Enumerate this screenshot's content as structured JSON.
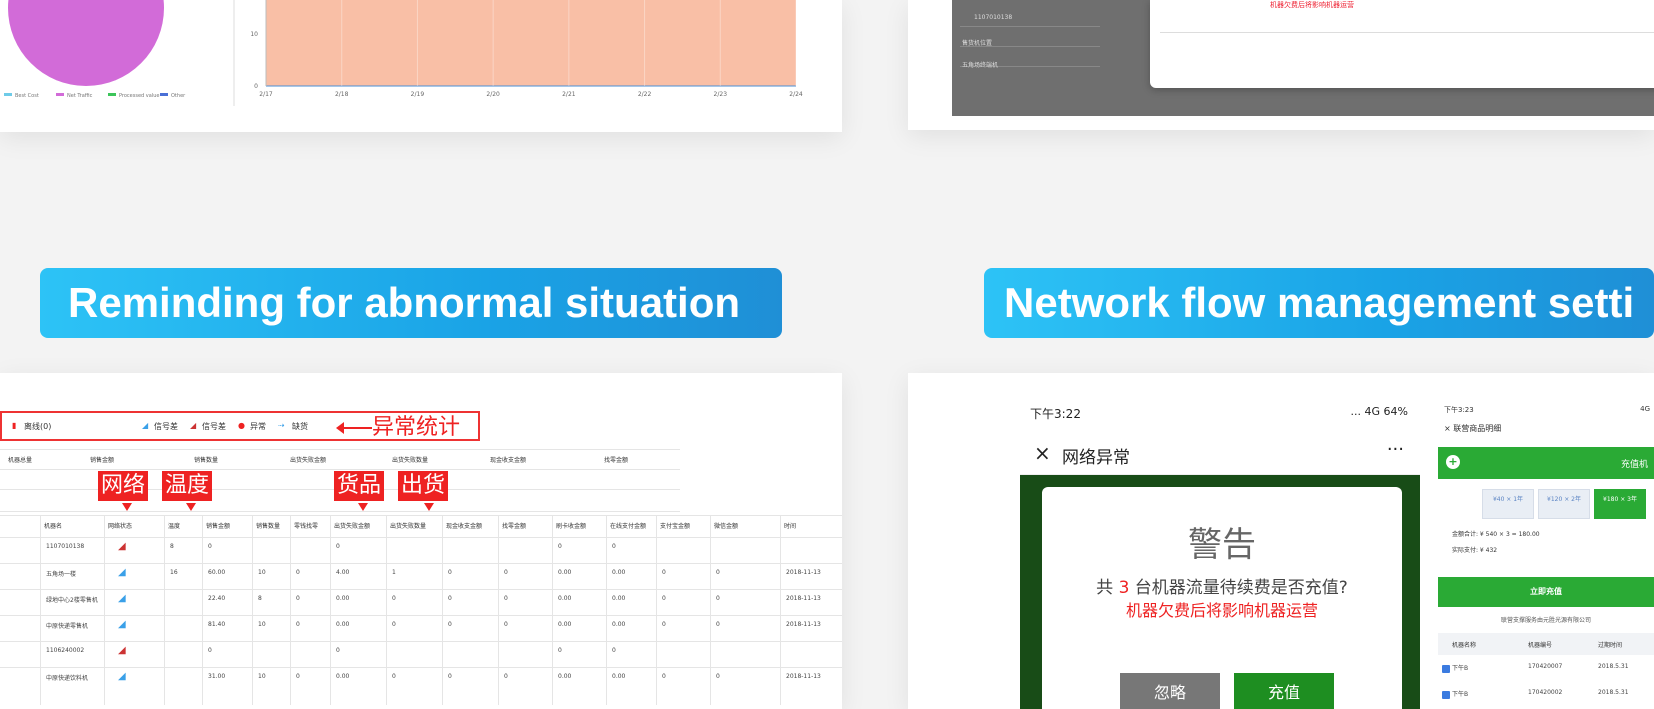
{
  "sections": {
    "left_title": "Reminding for abnormal situation",
    "right_title": "Network flow management setti"
  },
  "top_left": {
    "legend": [
      "Best Cost",
      "Net Traffic",
      "Processed value",
      "Other"
    ],
    "x_ticks": [
      "2/17",
      "2/18",
      "2/19",
      "2/20",
      "2/21",
      "2/22",
      "2/23",
      "2/24"
    ],
    "y_ticks": [
      "10",
      "0"
    ],
    "colors": {
      "pie": "#d26bd8",
      "area": "#f9bfa6"
    }
  },
  "top_right": {
    "rows": [
      "1107010138",
      "售货机位置",
      "五角场终端机"
    ],
    "modal_warning": "机器欠费后将影响机器运营"
  },
  "abnormal": {
    "legend_items": [
      "离线(0)",
      "信号差",
      "异常",
      "缺货"
    ],
    "stat_label": "异常统计",
    "tags": [
      "网络",
      "温度",
      "货品",
      "出货"
    ],
    "header_top": [
      "机器总量",
      "销售金额",
      "销售数量",
      "出货失败金额",
      "出货失败数量",
      "现金收支金额",
      "找零金额"
    ],
    "header": [
      "机器名",
      "网络状态",
      "温度",
      "销售金额",
      "销售数量",
      "零钱找零",
      "出货失败金额",
      "出货失败数量",
      "现金收支金额",
      "找零金额",
      "刷卡收金额",
      "在线支付金额",
      "支付宝金额",
      "微信金额",
      "时间"
    ],
    "rows": [
      [
        "1107010138",
        "",
        "8",
        "0",
        "",
        "",
        "0",
        "",
        "",
        "",
        "0",
        "0",
        "",
        "",
        ""
      ],
      [
        "五角场一楼",
        "",
        "16",
        "60.00",
        "10",
        "0",
        "4.00",
        "1",
        "0",
        "0",
        "0.00",
        "0.00",
        "0",
        "0",
        "2018-11-13"
      ],
      [
        "绿地中心2楼零售机",
        "",
        "",
        "22.40",
        "8",
        "0",
        "0.00",
        "0",
        "0",
        "0",
        "0.00",
        "0.00",
        "0",
        "0",
        "2018-11-13"
      ],
      [
        "中原快递零售机",
        "",
        "",
        "81.40",
        "10",
        "0",
        "0.00",
        "0",
        "0",
        "0",
        "0.00",
        "0.00",
        "0",
        "0",
        "2018-11-13"
      ],
      [
        "1106240002",
        "",
        "",
        "0",
        "",
        "",
        "0",
        "",
        "",
        "",
        "0",
        "0",
        "",
        "",
        ""
      ],
      [
        "中原快递饮料机",
        "",
        "",
        "31.00",
        "10",
        "0",
        "0.00",
        "0",
        "0",
        "0",
        "0.00",
        "0.00",
        "0",
        "0",
        "2018-11-13"
      ]
    ]
  },
  "phone": {
    "time": "下午3:22",
    "status_right": "... 4G 64%",
    "close_icon": "×",
    "title": "网络异常",
    "more": "···",
    "alert_title": "警告",
    "alert_msg_prefix": "共",
    "alert_msg_num": "3",
    "alert_msg_suffix": "台机器流量待续费是否充值?",
    "alert_warn": "机器欠费后将影响机器运营",
    "btn_ignore": "忽略",
    "btn_recharge": "充值"
  },
  "phone2": {
    "time": "下午3:23",
    "status_right": "4G",
    "nav": "× 联营商品明细",
    "bar_text": "充值机",
    "options": [
      "¥40 × 1年",
      "¥120 × 2年",
      "¥180 × 3年"
    ],
    "total_line": "金额合计: ¥ 540 × 3 = 180.00",
    "pay_line": "实际支付: ¥ 432",
    "cta": "立即充值",
    "note": "联营支撑服务由元胜光源有限公司",
    "th": [
      "机器名称",
      "机器编号",
      "过期时间"
    ],
    "rows": [
      [
        "下午B",
        "170420007",
        "2018.5.31"
      ],
      [
        "下午B",
        "170420002",
        "2018.5.31"
      ]
    ]
  }
}
